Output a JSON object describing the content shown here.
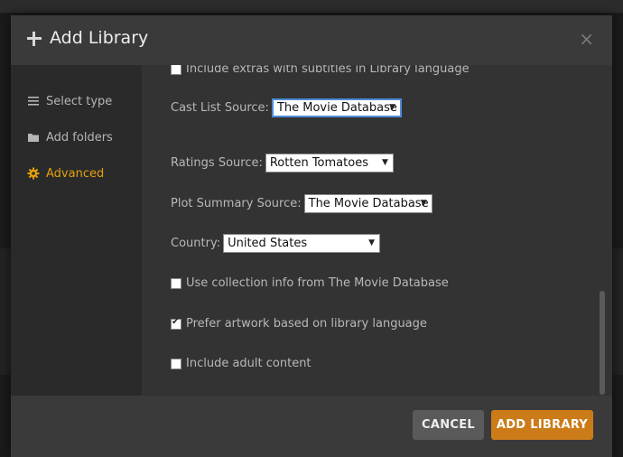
{
  "dialog": {
    "title": "Add Library",
    "close_glyph": "×"
  },
  "sidebar": {
    "items": [
      {
        "label": "Select type",
        "icon": "list-icon",
        "active": false
      },
      {
        "label": "Add folders",
        "icon": "folder-icon",
        "active": false
      },
      {
        "label": "Advanced",
        "icon": "gear-icon",
        "active": true
      }
    ]
  },
  "advanced": {
    "extras_subtitles": {
      "label": "Include extras with subtitles in Library language",
      "checked": false
    },
    "cast_list_source": {
      "label": "Cast List Source:",
      "value": "The Movie Database"
    },
    "ratings_source": {
      "label": "Ratings Source:",
      "value": "Rotten Tomatoes"
    },
    "plot_summary_source": {
      "label": "Plot Summary Source:",
      "value": "The Movie Database"
    },
    "country": {
      "label": "Country:",
      "value": "United States"
    },
    "collection_info": {
      "label": "Use collection info from The Movie Database",
      "checked": false
    },
    "prefer_artwork": {
      "label": "Prefer artwork based on library language",
      "checked": true
    },
    "adult_content": {
      "label": "Include adult content",
      "checked": false
    }
  },
  "footer": {
    "cancel_label": "CANCEL",
    "add_label": "ADD LIBRARY"
  },
  "colors": {
    "accent": "#e5a00d",
    "primary_button": "#cc7b19",
    "focus_ring": "#4d8cd6"
  }
}
